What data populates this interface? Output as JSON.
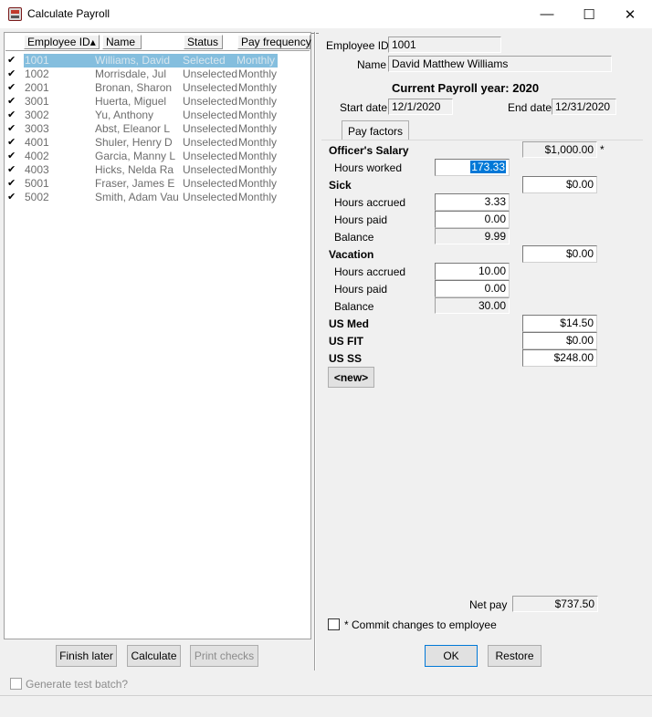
{
  "window": {
    "title": "Calculate Payroll",
    "minimize": "—",
    "maximize": "☐",
    "close": "✕"
  },
  "list": {
    "columns": [
      "Employee ID",
      "Name",
      "Status",
      "Pay frequency"
    ],
    "sort_indicator": "▴",
    "check_mark": "✔",
    "rows": [
      {
        "id": "1001",
        "name": "Williams, David",
        "status": "Selected",
        "freq": "Monthly"
      },
      {
        "id": "1002",
        "name": "Morrisdale, Jul",
        "status": "Unselected",
        "freq": "Monthly"
      },
      {
        "id": "2001",
        "name": "Bronan, Sharon",
        "status": "Unselected",
        "freq": "Monthly"
      },
      {
        "id": "3001",
        "name": "Huerta, Miguel",
        "status": "Unselected",
        "freq": "Monthly"
      },
      {
        "id": "3002",
        "name": "Yu, Anthony",
        "status": "Unselected",
        "freq": "Monthly"
      },
      {
        "id": "3003",
        "name": "Abst, Eleanor L",
        "status": "Unselected",
        "freq": "Monthly"
      },
      {
        "id": "4001",
        "name": "Shuler, Henry D",
        "status": "Unselected",
        "freq": "Monthly"
      },
      {
        "id": "4002",
        "name": "Garcia, Manny L",
        "status": "Unselected",
        "freq": "Monthly"
      },
      {
        "id": "4003",
        "name": "Hicks, Nelda Ra",
        "status": "Unselected",
        "freq": "Monthly"
      },
      {
        "id": "5001",
        "name": "Fraser, James E",
        "status": "Unselected",
        "freq": "Monthly"
      },
      {
        "id": "5002",
        "name": "Smith, Adam Vau",
        "status": "Unselected",
        "freq": "Monthly"
      }
    ]
  },
  "left_buttons": {
    "finish_later": "Finish later",
    "calculate": "Calculate",
    "print_checks": "Print checks"
  },
  "generate_test_batch": "Generate test batch?",
  "detail": {
    "employee_id_label": "Employee ID",
    "employee_id": "1001",
    "name_label": "Name",
    "name": "David Matthew Williams",
    "payroll_year": "Current Payroll year: 2020",
    "start_date_label": "Start date",
    "start_date": "12/1/2020",
    "end_date_label": "End date",
    "end_date": "12/31/2020",
    "tab": "Pay factors"
  },
  "pay_factors": {
    "officers_salary_label": "Officer's Salary",
    "officers_salary": "$1,000.00",
    "asterisk": "*",
    "hours_worked_label": "Hours worked",
    "hours_worked": "173.33",
    "sick_label": "Sick",
    "sick_amount": "$0.00",
    "sick_hours_accrued_label": "Hours accrued",
    "sick_hours_accrued": "3.33",
    "sick_hours_paid_label": "Hours paid",
    "sick_hours_paid": "0.00",
    "sick_balance_label": "Balance",
    "sick_balance": "9.99",
    "vacation_label": "Vacation",
    "vacation_amount": "$0.00",
    "vac_hours_accrued_label": "Hours accrued",
    "vac_hours_accrued": "10.00",
    "vac_hours_paid_label": "Hours paid",
    "vac_hours_paid": "0.00",
    "vac_balance_label": "Balance",
    "vac_balance": "30.00",
    "us_med_label": "US Med",
    "us_med": "$14.50",
    "us_fit_label": "US FIT",
    "us_fit": "$0.00",
    "us_ss_label": "US SS",
    "us_ss": "$248.00",
    "new_button": "<new>"
  },
  "summary": {
    "net_pay_label": "Net pay",
    "net_pay": "$737.50",
    "commit_label": "* Commit changes to employee",
    "ok": "OK",
    "restore": "Restore"
  }
}
